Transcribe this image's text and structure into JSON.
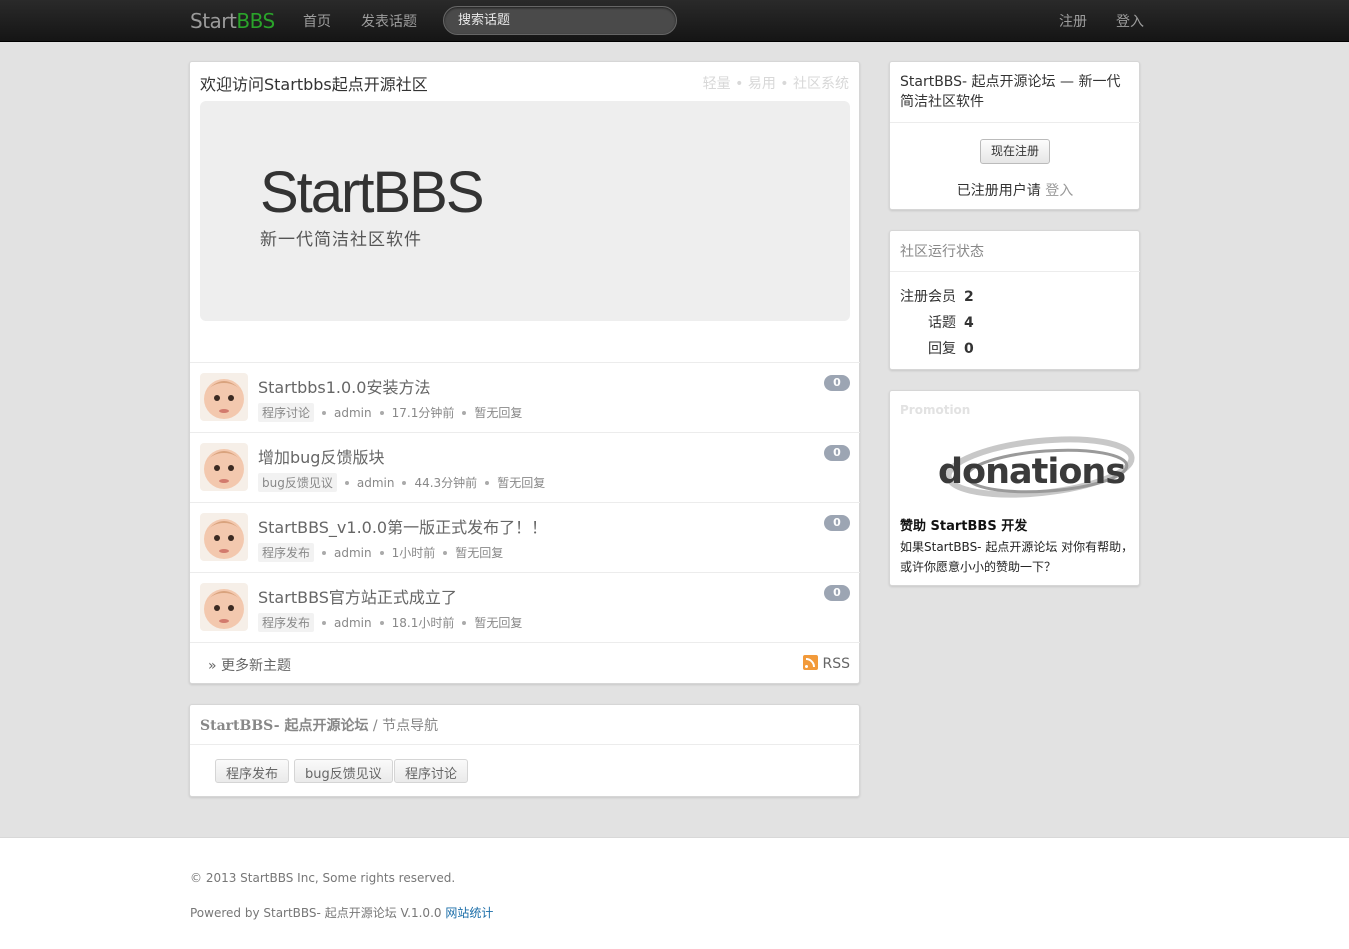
{
  "header": {
    "brand_part1": "Start",
    "brand_part2": "BBS",
    "nav": [
      "首页",
      "发表话题"
    ],
    "search_placeholder": "搜索话题",
    "register": "注册",
    "login": "登入"
  },
  "welcome": {
    "title": "欢迎访问Startbbs起点开源社区",
    "tags": "轻量 • 易用 • 社区系统",
    "hero_title": "StartBBS",
    "hero_subtitle": "新一代简洁社区软件"
  },
  "topics": [
    {
      "title": "Startbbs1.0.0安装方法",
      "node": "程序讨论",
      "user": "admin",
      "time": "17.1分钟前",
      "reply": "暂无回复",
      "count": "0"
    },
    {
      "title": "增加bug反馈版块",
      "node": "bug反馈见议",
      "user": "admin",
      "time": "44.3分钟前",
      "reply": "暂无回复",
      "count": "0"
    },
    {
      "title": "StartBBS_v1.0.0第一版正式发布了！！",
      "node": "程序发布",
      "user": "admin",
      "time": "1小时前",
      "reply": "暂无回复",
      "count": "0"
    },
    {
      "title": "StartBBS官方站正式成立了",
      "node": "程序发布",
      "user": "admin",
      "time": "18.1小时前",
      "reply": "暂无回复",
      "count": "0"
    }
  ],
  "more": {
    "label": "» 更多新主题",
    "rss": "RSS"
  },
  "nodes_nav": {
    "site": "StartBBS- 起点开源论坛",
    "sep": " / 节点导航",
    "nodes": [
      "程序发布",
      "bug反馈见议",
      "程序讨论"
    ]
  },
  "sidebar": {
    "intro": "StartBBS- 起点开源论坛 — 新一代简洁社区软件",
    "register_btn": "现在注册",
    "login_hint": "已注册用户请 ",
    "login_link": "登入",
    "stats_title": "社区运行状态",
    "stats": [
      {
        "label": "注册会员",
        "value": "2"
      },
      {
        "label": "话题",
        "value": "4"
      },
      {
        "label": "回复",
        "value": "0"
      }
    ],
    "promo_head": "Promotion",
    "promo_logo": "donations",
    "promo_title": "赞助 StartBBS 开发",
    "promo_text": "如果StartBBS- 起点开源论坛 对你有帮助，或许你愿意小小的赞助一下？"
  },
  "footer": {
    "copyright": "© 2013 StartBBS Inc, Some rights reserved.",
    "powered": "Powered by StartBBS- 起点开源论坛 V.1.0.0 ",
    "stats_link": "网站统计"
  },
  "colors": {
    "brand_green": "#2aa32a",
    "badge": "#9ca5b3",
    "link_blue": "#1a6da8"
  }
}
